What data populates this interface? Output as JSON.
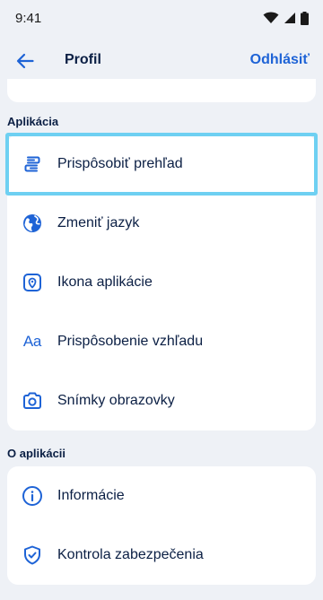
{
  "status_bar": {
    "time": "9:41"
  },
  "header": {
    "title": "Profil",
    "logout_label": "Odhlásiť"
  },
  "sections": {
    "app": {
      "title": "Aplikácia",
      "items": [
        {
          "label": "Prispôsobiť prehľad",
          "icon": "customize-overview-icon"
        },
        {
          "label": "Zmeniť jazyk",
          "icon": "globe-icon"
        },
        {
          "label": "Ikona aplikácie",
          "icon": "app-icon-icon"
        },
        {
          "label": "Prispôsobenie vzhľadu",
          "icon": "text-size-icon",
          "glyph": "Aa"
        },
        {
          "label": "Snímky obrazovky",
          "icon": "camera-icon"
        }
      ]
    },
    "about": {
      "title": "O aplikácii",
      "items": [
        {
          "label": "Informácie",
          "icon": "info-icon"
        },
        {
          "label": "Kontrola zabezpečenia",
          "icon": "shield-check-icon"
        }
      ]
    }
  },
  "colors": {
    "accent": "#1e63d6",
    "background": "#eef1f6",
    "card": "#ffffff",
    "text": "#0b1f44",
    "focus_ring": "#6ed0f2"
  }
}
